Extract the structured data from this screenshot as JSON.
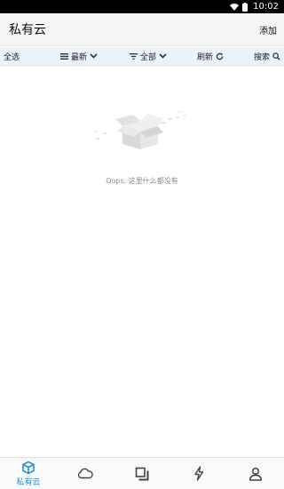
{
  "status": {
    "time": "10:02"
  },
  "header": {
    "title": "私有云",
    "add_label": "添加"
  },
  "toolbar": {
    "select_all": "全选",
    "sort_label": "最新",
    "filter_label": "全部",
    "refresh_label": "刷新",
    "search_label": "搜索"
  },
  "empty_state": {
    "message": "Oops, 这里什么都没有"
  },
  "bottom_nav": [
    {
      "label": "私有云",
      "icon": "cube-icon",
      "active": true
    },
    {
      "label": "",
      "icon": "cloud-icon",
      "active": false
    },
    {
      "label": "",
      "icon": "windows-icon",
      "active": false
    },
    {
      "label": "",
      "icon": "bolt-icon",
      "active": false
    },
    {
      "label": "",
      "icon": "user-icon",
      "active": false
    }
  ],
  "colors": {
    "accent": "#2a8fd6",
    "toolbar_bg": "#eaf2fb",
    "header_bg": "#f5f5f5"
  }
}
